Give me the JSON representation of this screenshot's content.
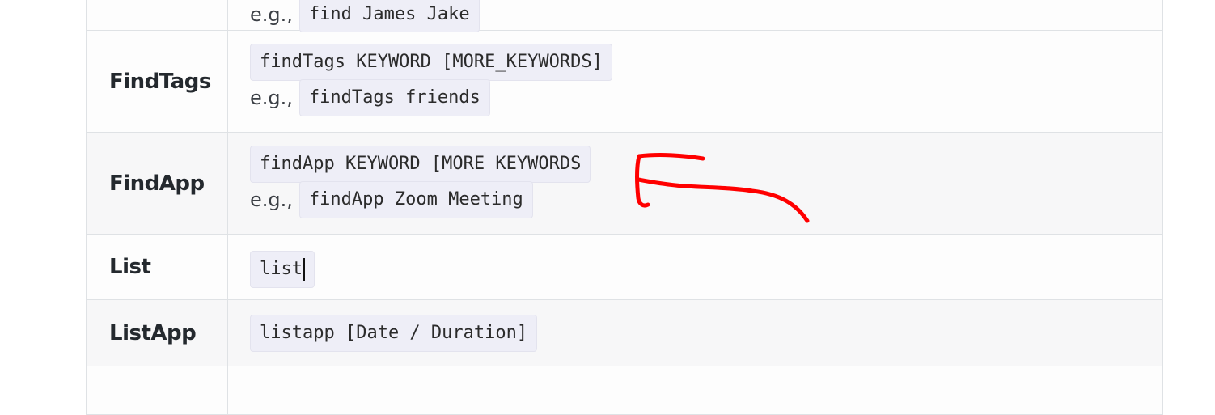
{
  "rows": [
    {
      "name": "",
      "format": "",
      "example": "find James Jake"
    },
    {
      "name": "FindTags",
      "format": "findTags KEYWORD [MORE_KEYWORDS]",
      "example": "findTags friends"
    },
    {
      "name": "FindApp",
      "format": "findApp KEYWORD [MORE KEYWORDS",
      "example": "findApp Zoom Meeting"
    },
    {
      "name": "List",
      "format": "list"
    },
    {
      "name": "ListApp",
      "format": "listapp [Date / Duration]"
    }
  ],
  "eg_label": "e.g.,",
  "annotation": {
    "color": "#ff0000",
    "shape": "red-arrow"
  }
}
